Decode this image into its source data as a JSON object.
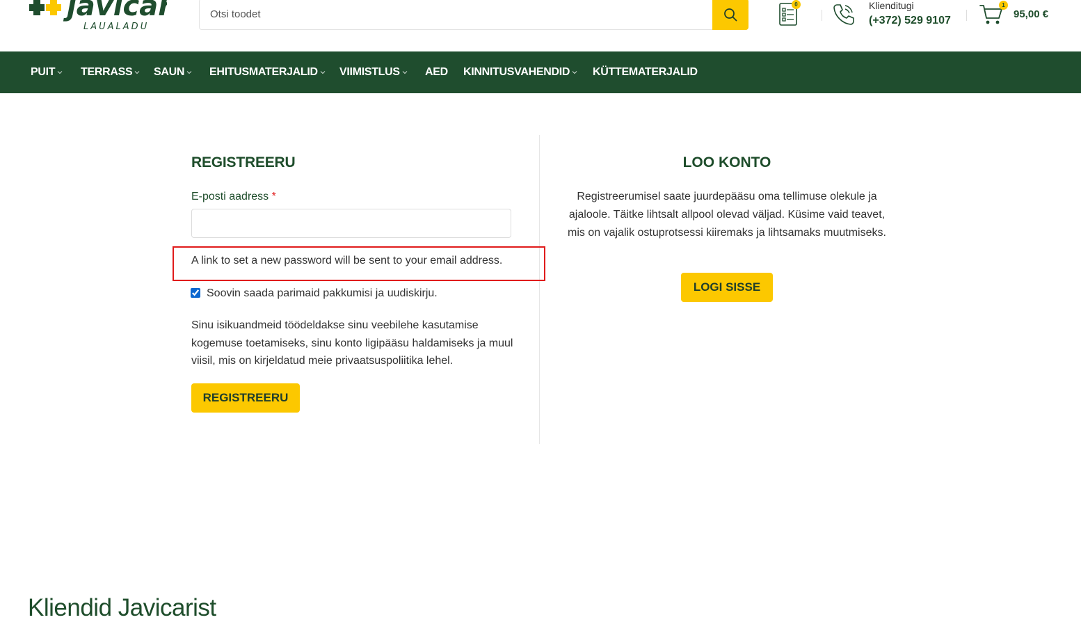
{
  "header": {
    "logo_text": "javicar",
    "logo_subtext": "LAUALADU",
    "search_placeholder": "Otsi toodet",
    "wishlist_count": "0",
    "support_label": "Klienditugi",
    "support_phone": "(+372) 529 9107",
    "cart_count": "1",
    "cart_total": "95,00 €"
  },
  "nav": {
    "items": [
      {
        "label": "PUIT",
        "dropdown": true
      },
      {
        "label": "TERRASS",
        "dropdown": true
      },
      {
        "label": "SAUN",
        "dropdown": true
      },
      {
        "label": "EHITUSMATERJALID",
        "dropdown": true
      },
      {
        "label": "VIIMISTLUS",
        "dropdown": true
      },
      {
        "label": "AED",
        "dropdown": false
      },
      {
        "label": "KINNITUSVAHENDID",
        "dropdown": true
      },
      {
        "label": "KÜTTEMATERJALID",
        "dropdown": false
      }
    ]
  },
  "register": {
    "title": "REGISTREERU",
    "email_label": "E-posti aadress",
    "required_mark": "*",
    "email_value": "",
    "password_note": "A link to set a new password will be sent to your email address.",
    "newsletter_label": "Soovin saada parimaid pakkumisi ja uudiskirju.",
    "newsletter_checked": true,
    "privacy_text": "Sinu isikuandmeid töödeldakse sinu veebilehe kasutamise kogemuse toetamiseks, sinu konto ligipääsu haldamiseks ja muul viisil, mis on kirjeldatud meie privaatsuspoliitika lehel.",
    "submit_label": "REGISTREERU"
  },
  "create_account": {
    "title": "LOO KONTO",
    "text": "Registreerumisel saate juurdepääsu oma tellimuse olekule ja ajaloole. Täitke lihtsalt allpool olevad väljad. Küsime vaid teavet, mis on vajalik ostuprotsessi kiiremaks ja lihtsamaks muutmiseks.",
    "login_label": "LOGI SISSE"
  },
  "footer_heading": "Kliendid Javicarist",
  "colors": {
    "brand_green": "#1f4d2e",
    "accent_yellow": "#fcc800",
    "highlight_red": "#e01b1b"
  }
}
